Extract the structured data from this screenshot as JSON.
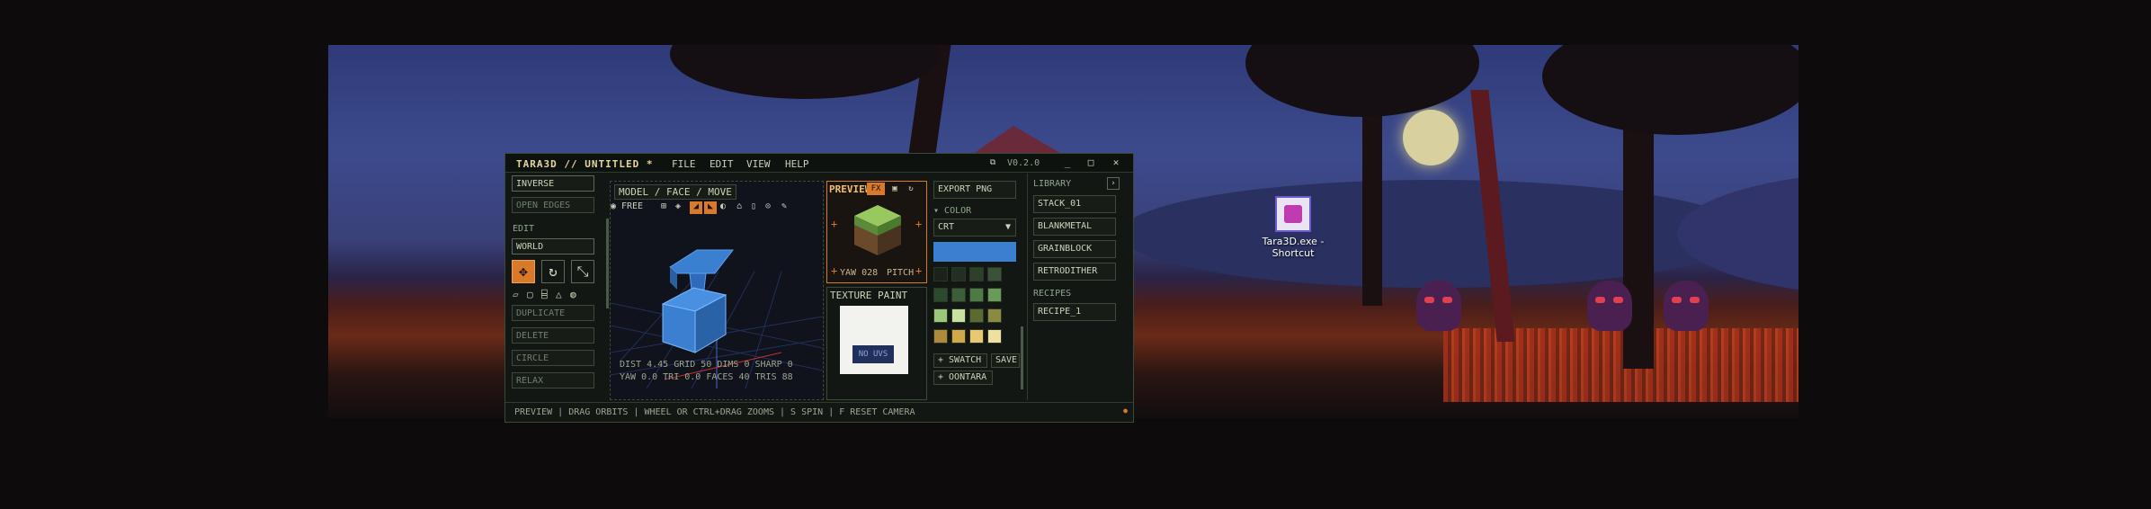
{
  "app": {
    "title": "TARA3D // UNTITLED *",
    "version": "V0.2.0",
    "menu": [
      "FILE",
      "EDIT",
      "VIEW",
      "HELP"
    ]
  },
  "left_panel": {
    "inverse": "INVERSE",
    "open_edges": "OPEN EDGES",
    "edit_header": "EDIT",
    "space": "WORLD",
    "duplicate": "DUPLICATE",
    "delete": "DELETE",
    "circle": "CIRCLE",
    "relax": "RELAX"
  },
  "viewport": {
    "mode": "MODEL / FACE / MOVE",
    "camera_mode": "FREE",
    "stats_line1": "DIST 4.45 GRID 50 DIMS 0 SHARP 0",
    "stats_line2": "YAW 0.0 TRI 0.0 FACES 40 TRIS 88"
  },
  "preview": {
    "title": "PREVIEW",
    "fx_label": "FX",
    "yaw_label": "YAW 028",
    "pitch_label": "PITCH"
  },
  "texture": {
    "title": "TEXTURE PAINT",
    "no_uvs": "NO UVS"
  },
  "color_panel": {
    "export": "EXPORT PNG",
    "color_header": "COLOR",
    "preset": "CRT",
    "current_color": "#3a7fd0",
    "swatches": [
      "#1a221a",
      "#223022",
      "#2e402c",
      "#3a5236",
      "#2e4a2c",
      "#3c5e38",
      "#4e7a44",
      "#6a9a58",
      "#9ac878",
      "#c8e0a0",
      "#5a6a30",
      "#8a8a40",
      "#b08a3a",
      "#d0a848",
      "#e8c870",
      "#f0e0a0"
    ],
    "add_swatch": "+ SWATCH",
    "save": "SAVE",
    "palette_name": "+ OONTARA"
  },
  "library": {
    "header": "LIBRARY",
    "items": [
      "STACK_01",
      "BLANKMETAL",
      "GRAINBLOCK",
      "RETRODITHER"
    ],
    "recipes_header": "RECIPES",
    "recipes": [
      "RECIPE_1"
    ]
  },
  "status_bar": {
    "text": "PREVIEW  |  DRAG ORBITS  |  WHEEL OR CTRL+DRAG ZOOMS  |  S SPIN  |  F RESET CAMERA"
  },
  "desktop_icon": {
    "label_line1": "Tara3D.exe -",
    "label_line2": "Shortcut"
  }
}
